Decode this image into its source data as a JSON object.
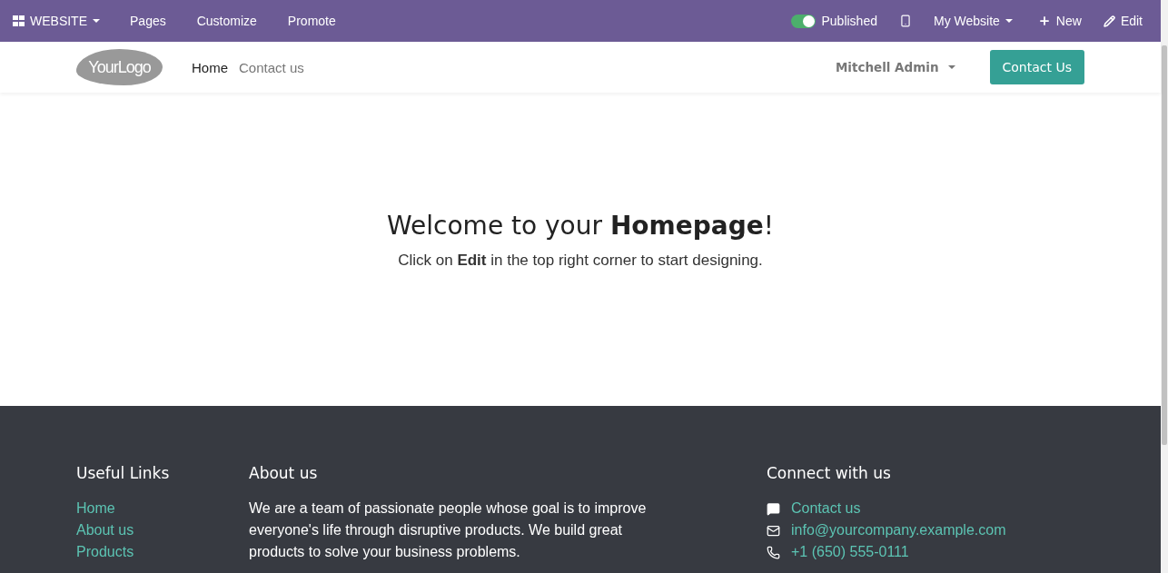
{
  "admin_bar": {
    "app_menu": "WEBSITE",
    "menu": [
      "Pages",
      "Customize",
      "Promote"
    ],
    "published": {
      "label": "Published",
      "on": true
    },
    "website": "My Website",
    "new": "New",
    "edit": "Edit"
  },
  "navbar": {
    "logo": "**Your**Logo",
    "links": [
      {
        "label": "Home",
        "selected": true
      },
      {
        "label": "Contact us",
        "selected": false
      }
    ],
    "user": "Mitchell Admin",
    "cta": "Contact Us"
  },
  "hero": {
    "title": "Welcome to your **Homepage**!",
    "subtitle": "Click on **Edit** in the top right corner to start designing."
  },
  "footer": {
    "links_title": "Useful Links",
    "links": [
      "Home",
      "About us",
      "Products"
    ],
    "about_title": "About us",
    "about_text": "We are a team of passionate people whose goal is to improve everyone's life through disruptive products. We build great products to solve your business problems.",
    "connect_title": "Connect with us",
    "contacts": [
      {
        "kind": "chat",
        "label": "Contact us"
      },
      {
        "kind": "mail",
        "label": "info@yourcompany.example.com"
      },
      {
        "kind": "phone",
        "label": "+1 (650) 555-0111"
      }
    ]
  }
}
